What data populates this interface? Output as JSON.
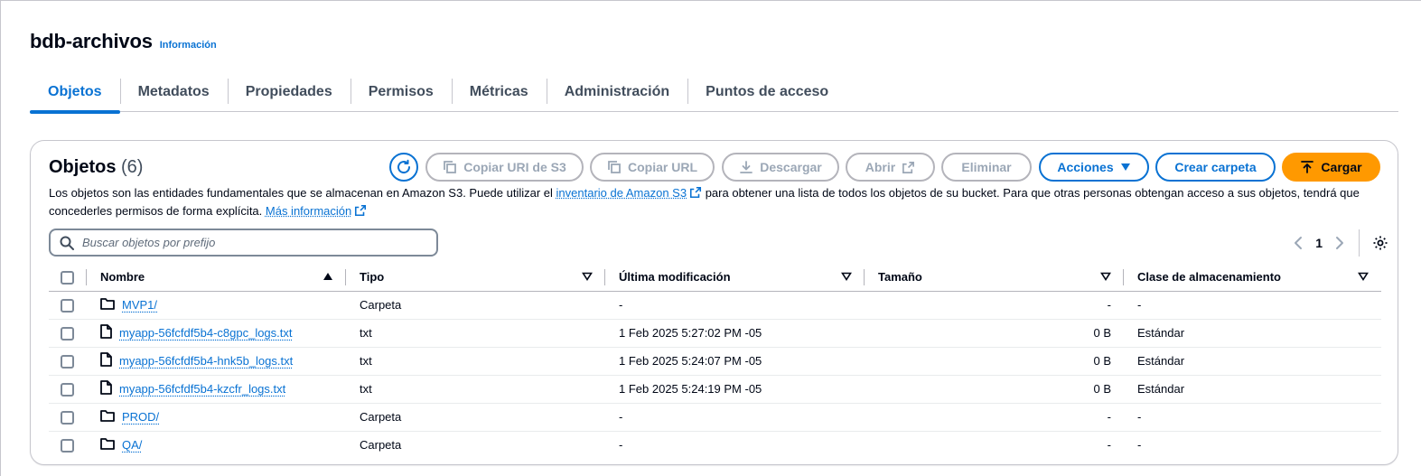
{
  "bucket": {
    "name": "bdb-archivos",
    "info_label": "Información"
  },
  "tabs": [
    {
      "label": "Objetos",
      "active": true
    },
    {
      "label": "Metadatos"
    },
    {
      "label": "Propiedades"
    },
    {
      "label": "Permisos"
    },
    {
      "label": "Métricas"
    },
    {
      "label": "Administración"
    },
    {
      "label": "Puntos de acceso"
    }
  ],
  "objects_panel": {
    "title": "Objetos",
    "count": "(6)",
    "buttons": {
      "copy_s3_uri": "Copiar URI de S3",
      "copy_url": "Copiar URL",
      "download": "Descargar",
      "open": "Abrir",
      "delete": "Eliminar",
      "actions": "Acciones",
      "create_folder": "Crear carpeta",
      "upload": "Cargar"
    },
    "description": {
      "part1": "Los objetos son las entidades fundamentales que se almacenan en Amazon S3. Puede utilizar el ",
      "link1": "inventario de Amazon S3",
      "part2": " para obtener una lista de todos los objetos de su bucket. Para que otras personas obtengan acceso a sus objetos, tendrá que concederles permisos de forma explícita. ",
      "link2": "Más información"
    },
    "search_placeholder": "Buscar objetos por prefijo",
    "page_number": "1",
    "columns": {
      "name": "Nombre",
      "type": "Tipo",
      "modified": "Última modificación",
      "size": "Tamaño",
      "storage_class": "Clase de almacenamiento"
    },
    "rows": [
      {
        "icon": "folder-icon",
        "name": "MVP1/",
        "type": "Carpeta",
        "modified": "-",
        "size": "-",
        "storage_class": "-"
      },
      {
        "icon": "file-icon",
        "name": "myapp-56fcfdf5b4-c8gpc_logs.txt",
        "type": "txt",
        "modified": "1 Feb 2025 5:27:02 PM -05",
        "size": "0 B",
        "storage_class": "Estándar"
      },
      {
        "icon": "file-icon",
        "name": "myapp-56fcfdf5b4-hnk5b_logs.txt",
        "type": "txt",
        "modified": "1 Feb 2025 5:24:07 PM -05",
        "size": "0 B",
        "storage_class": "Estándar"
      },
      {
        "icon": "file-icon",
        "name": "myapp-56fcfdf5b4-kzcfr_logs.txt",
        "type": "txt",
        "modified": "1 Feb 2025 5:24:19 PM -05",
        "size": "0 B",
        "storage_class": "Estándar"
      },
      {
        "icon": "folder-icon",
        "name": "PROD/",
        "type": "Carpeta",
        "modified": "-",
        "size": "-",
        "storage_class": "-"
      },
      {
        "icon": "folder-icon",
        "name": "QA/",
        "type": "Carpeta",
        "modified": "-",
        "size": "-",
        "storage_class": "-"
      }
    ]
  },
  "colors": {
    "accent": "#0972d3",
    "primary_button": "#ff9900",
    "text": "#000716",
    "disabled": "#9ba7b6"
  }
}
